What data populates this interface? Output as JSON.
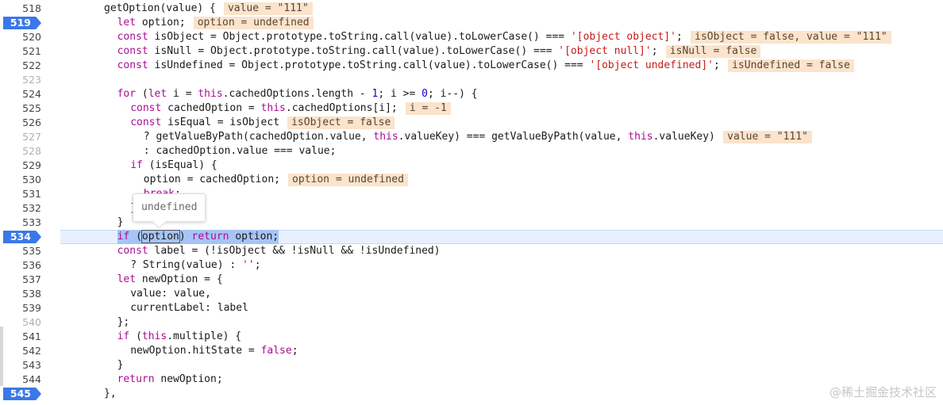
{
  "editor": {
    "lines": [
      {
        "num": "518",
        "breakpoint": false,
        "faded": false,
        "indent": 0,
        "code": [
          {
            "t": "getOption(value) {"
          }
        ],
        "inline": "value = \"111\""
      },
      {
        "num": "519",
        "breakpoint": true,
        "faded": false,
        "indent": 1,
        "code": [
          {
            "t": "let",
            "c": "kw"
          },
          {
            "t": " option;"
          }
        ],
        "inline": "option = undefined"
      },
      {
        "num": "520",
        "breakpoint": false,
        "faded": false,
        "indent": 1,
        "code": [
          {
            "t": "const",
            "c": "kw"
          },
          {
            "t": " isObject = Object.prototype.toString.call(value).toLowerCase() === "
          },
          {
            "t": "'[object object]'",
            "c": "str"
          },
          {
            "t": ";"
          }
        ],
        "inline": "isObject = false, value = \"111\""
      },
      {
        "num": "521",
        "breakpoint": false,
        "faded": false,
        "indent": 1,
        "code": [
          {
            "t": "const",
            "c": "kw"
          },
          {
            "t": " isNull = Object.prototype.toString.call(value).toLowerCase() === "
          },
          {
            "t": "'[object null]'",
            "c": "str"
          },
          {
            "t": ";"
          }
        ],
        "inline": "isNull = false"
      },
      {
        "num": "522",
        "breakpoint": false,
        "faded": false,
        "indent": 1,
        "code": [
          {
            "t": "const",
            "c": "kw"
          },
          {
            "t": " isUndefined = Object.prototype.toString.call(value).toLowerCase() === "
          },
          {
            "t": "'[object undefined]'",
            "c": "str"
          },
          {
            "t": ";"
          }
        ],
        "inline": "isUndefined = false"
      },
      {
        "num": "523",
        "breakpoint": false,
        "faded": true,
        "indent": 0,
        "code": [],
        "inline": ""
      },
      {
        "num": "524",
        "breakpoint": false,
        "faded": false,
        "indent": 1,
        "code": [
          {
            "t": "for",
            "c": "kw"
          },
          {
            "t": " ("
          },
          {
            "t": "let",
            "c": "kw"
          },
          {
            "t": " i = "
          },
          {
            "t": "this",
            "c": "kw"
          },
          {
            "t": ".cachedOptions.length - "
          },
          {
            "t": "1",
            "c": "num"
          },
          {
            "t": "; i >= "
          },
          {
            "t": "0",
            "c": "num"
          },
          {
            "t": "; i--) {"
          }
        ],
        "inline": ""
      },
      {
        "num": "525",
        "breakpoint": false,
        "faded": false,
        "indent": 2,
        "code": [
          {
            "t": "const",
            "c": "kw"
          },
          {
            "t": " cachedOption = "
          },
          {
            "t": "this",
            "c": "kw"
          },
          {
            "t": ".cachedOptions[i];"
          }
        ],
        "inline": "i = -1"
      },
      {
        "num": "526",
        "breakpoint": false,
        "faded": false,
        "indent": 2,
        "code": [
          {
            "t": "const",
            "c": "kw"
          },
          {
            "t": " isEqual = isObject"
          }
        ],
        "inline": "isObject = false"
      },
      {
        "num": "527",
        "breakpoint": false,
        "faded": true,
        "indent": 3,
        "code": [
          {
            "t": "? getValueByPath(cachedOption.value, "
          },
          {
            "t": "this",
            "c": "kw"
          },
          {
            "t": ".valueKey) === getValueByPath(value, "
          },
          {
            "t": "this",
            "c": "kw"
          },
          {
            "t": ".valueKey)"
          }
        ],
        "inline": "value = \"111\""
      },
      {
        "num": "528",
        "breakpoint": false,
        "faded": true,
        "indent": 3,
        "code": [
          {
            "t": ": cachedOption.value === value;"
          }
        ],
        "inline": ""
      },
      {
        "num": "529",
        "breakpoint": false,
        "faded": false,
        "indent": 2,
        "code": [
          {
            "t": "if",
            "c": "kw"
          },
          {
            "t": " (isEqual) {"
          }
        ],
        "inline": ""
      },
      {
        "num": "530",
        "breakpoint": false,
        "faded": false,
        "indent": 3,
        "code": [
          {
            "t": "option = cachedOption;"
          }
        ],
        "inline": "option = undefined"
      },
      {
        "num": "531",
        "breakpoint": false,
        "faded": false,
        "indent": 3,
        "code": [
          {
            "t": "break",
            "c": "kw"
          },
          {
            "t": ";"
          }
        ],
        "inline": ""
      },
      {
        "num": "532",
        "breakpoint": false,
        "faded": false,
        "indent": 2,
        "code": [
          {
            "t": "}"
          }
        ],
        "inline": ""
      },
      {
        "num": "533",
        "breakpoint": false,
        "faded": false,
        "indent": 1,
        "code": [
          {
            "t": "}"
          }
        ],
        "inline": ""
      },
      {
        "num": "534",
        "breakpoint": true,
        "current": true,
        "faded": false,
        "indent": 1,
        "code": [
          {
            "t": "if",
            "c": "kw"
          },
          {
            "t": " ("
          },
          {
            "t": "option",
            "c": "selword"
          },
          {
            "t": ") "
          },
          {
            "t": "return",
            "c": "kw"
          },
          {
            "t": " option;"
          }
        ],
        "inline": ""
      },
      {
        "num": "535",
        "breakpoint": false,
        "faded": false,
        "indent": 1,
        "code": [
          {
            "t": "const",
            "c": "kw"
          },
          {
            "t": " label = (!isObject && !isNull && !isUndefined)"
          }
        ],
        "inline": ""
      },
      {
        "num": "536",
        "breakpoint": false,
        "faded": false,
        "indent": 2,
        "code": [
          {
            "t": "? String(value) : "
          },
          {
            "t": "''",
            "c": "str"
          },
          {
            "t": ";"
          }
        ],
        "inline": ""
      },
      {
        "num": "537",
        "breakpoint": false,
        "faded": false,
        "indent": 1,
        "code": [
          {
            "t": "let",
            "c": "kw"
          },
          {
            "t": " newOption = {"
          }
        ],
        "inline": ""
      },
      {
        "num": "538",
        "breakpoint": false,
        "faded": false,
        "indent": 2,
        "code": [
          {
            "t": "value: value,"
          }
        ],
        "inline": ""
      },
      {
        "num": "539",
        "breakpoint": false,
        "faded": false,
        "indent": 2,
        "code": [
          {
            "t": "currentLabel: label"
          }
        ],
        "inline": ""
      },
      {
        "num": "540",
        "breakpoint": false,
        "faded": true,
        "indent": 1,
        "code": [
          {
            "t": "};"
          }
        ],
        "inline": ""
      },
      {
        "num": "541",
        "breakpoint": false,
        "faded": false,
        "indent": 1,
        "code": [
          {
            "t": "if",
            "c": "kw"
          },
          {
            "t": " ("
          },
          {
            "t": "this",
            "c": "kw"
          },
          {
            "t": ".multiple) {"
          }
        ],
        "inline": ""
      },
      {
        "num": "542",
        "breakpoint": false,
        "faded": false,
        "indent": 2,
        "code": [
          {
            "t": "newOption.hitState = "
          },
          {
            "t": "false",
            "c": "kw"
          },
          {
            "t": ";"
          }
        ],
        "inline": ""
      },
      {
        "num": "543",
        "breakpoint": false,
        "faded": false,
        "indent": 1,
        "code": [
          {
            "t": "}"
          }
        ],
        "inline": ""
      },
      {
        "num": "544",
        "breakpoint": false,
        "faded": false,
        "indent": 1,
        "code": [
          {
            "t": "return",
            "c": "kw"
          },
          {
            "t": " newOption;"
          }
        ],
        "inline": ""
      },
      {
        "num": "545",
        "breakpoint": true,
        "faded": false,
        "indent": 0,
        "code": [
          {
            "t": "},"
          }
        ],
        "inline": ""
      }
    ]
  },
  "tooltip": {
    "text": "undefined"
  },
  "watermark": {
    "text": "@稀土掘金技术社区"
  }
}
